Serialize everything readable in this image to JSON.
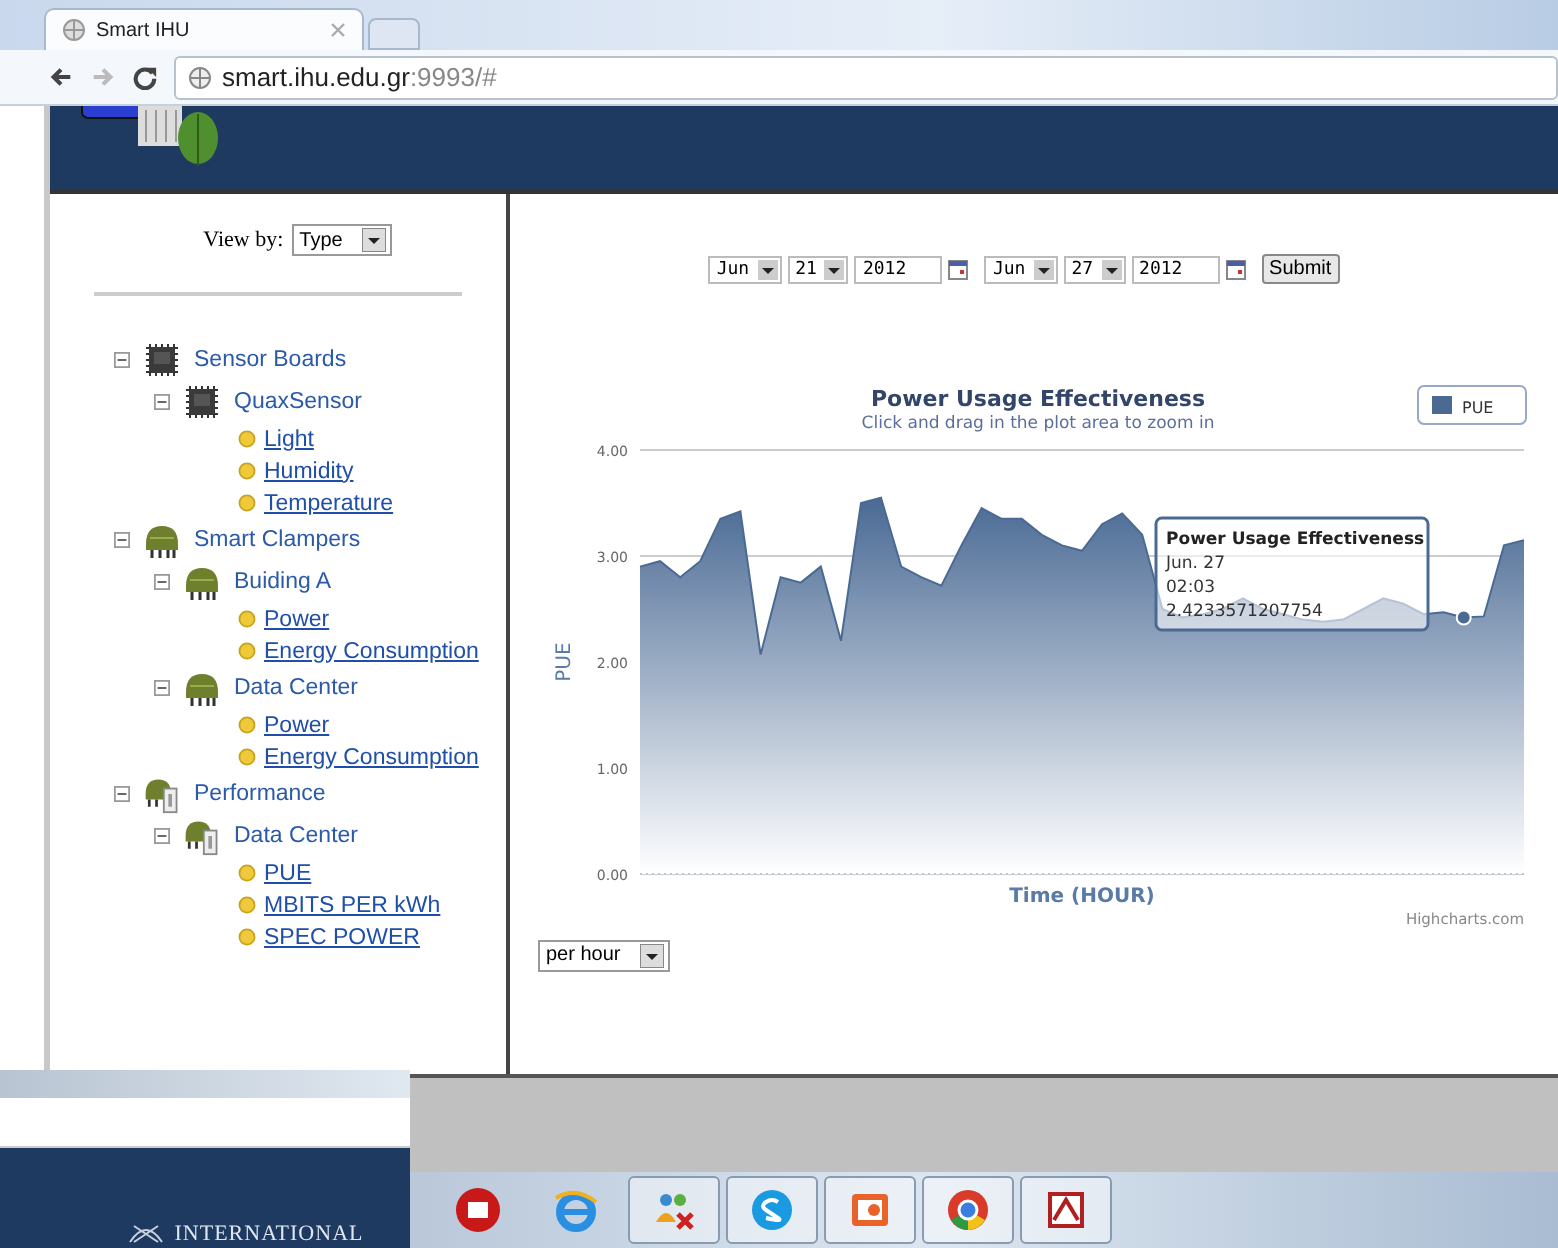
{
  "browser": {
    "tab_title": "Smart IHU",
    "url_host": "smart.ihu.edu.gr",
    "url_rest": ":9993/#"
  },
  "sidebar": {
    "view_by_label": "View by:",
    "view_by_value": "Type",
    "tree": [
      {
        "kind": "chip",
        "label": "Sensor Boards",
        "expanded": true,
        "children": [
          {
            "kind": "chip",
            "label": "QuaxSensor",
            "expanded": true,
            "children": [
              {
                "kind": "leaf",
                "label": "Light"
              },
              {
                "kind": "leaf",
                "label": "Humidity"
              },
              {
                "kind": "leaf",
                "label": "Temperature"
              }
            ]
          }
        ]
      },
      {
        "kind": "clamp",
        "label": "Smart Clampers",
        "expanded": true,
        "children": [
          {
            "kind": "clamp",
            "label": "Buiding A",
            "expanded": true,
            "children": [
              {
                "kind": "leaf",
                "label": "Power"
              },
              {
                "kind": "leaf",
                "label": "Energy Consumption"
              }
            ]
          },
          {
            "kind": "clamp",
            "label": "Data Center",
            "expanded": true,
            "children": [
              {
                "kind": "leaf",
                "label": "Power"
              },
              {
                "kind": "leaf",
                "label": "Energy Consumption"
              }
            ]
          }
        ]
      },
      {
        "kind": "meter",
        "label": "Performance",
        "expanded": true,
        "children": [
          {
            "kind": "meter",
            "label": "Data Center",
            "expanded": true,
            "children": [
              {
                "kind": "leaf",
                "label": "PUE"
              },
              {
                "kind": "leaf",
                "label": "MBITS PER kWh"
              },
              {
                "kind": "leaf",
                "label": "SPEC POWER"
              }
            ]
          }
        ]
      }
    ]
  },
  "date_range": {
    "from": {
      "month": "Jun",
      "day": "21",
      "year": "2012"
    },
    "to": {
      "month": "Jun",
      "day": "27",
      "year": "2012"
    },
    "submit": "Submit"
  },
  "chart": {
    "title": "Power Usage Effectiveness",
    "subtitle": "Click and drag in the plot area to zoom in",
    "credits": "Highcharts.com",
    "tooltip": {
      "title": "Power Usage Effectiveness",
      "date": "Jun. 27",
      "time": "02:03",
      "value": "2.4233571207754"
    },
    "chart_data": {
      "type": "area",
      "xlabel": "Time (HOUR)",
      "ylabel": "PUE",
      "grid": true,
      "ylim": [
        0,
        4
      ],
      "yticks": [
        {
          "value": 0,
          "label": "0.00"
        },
        {
          "value": 1,
          "label": "1.00"
        },
        {
          "value": 2,
          "label": "2.00"
        },
        {
          "value": 3,
          "label": "3.00"
        },
        {
          "value": 4,
          "label": "4.00"
        }
      ],
      "series": [
        {
          "name": "PUE",
          "color": "#4a6a94",
          "values": [
            2.9,
            2.95,
            2.8,
            2.95,
            3.35,
            3.42,
            2.07,
            2.8,
            2.75,
            2.9,
            2.2,
            3.5,
            3.55,
            2.9,
            2.8,
            2.72,
            3.1,
            3.45,
            3.35,
            3.35,
            3.2,
            3.1,
            3.05,
            3.3,
            3.4,
            3.2,
            2.5,
            2.42,
            2.45,
            2.5,
            2.6,
            2.5,
            2.45,
            2.4,
            2.38,
            2.4,
            2.5,
            2.6,
            2.55,
            2.45,
            2.47,
            2.42,
            2.43,
            3.1,
            3.15
          ]
        }
      ]
    }
  },
  "interval": "per hour",
  "overlay_window": {
    "text": "INTERNATIONAL"
  },
  "taskbar": {
    "apps": [
      {
        "kind": "red-app",
        "running": false
      },
      {
        "kind": "ie",
        "running": false
      },
      {
        "kind": "people",
        "running": true
      },
      {
        "kind": "skype",
        "running": true
      },
      {
        "kind": "slides",
        "running": true
      },
      {
        "kind": "chrome",
        "running": true
      },
      {
        "kind": "pdf",
        "running": true
      }
    ]
  }
}
